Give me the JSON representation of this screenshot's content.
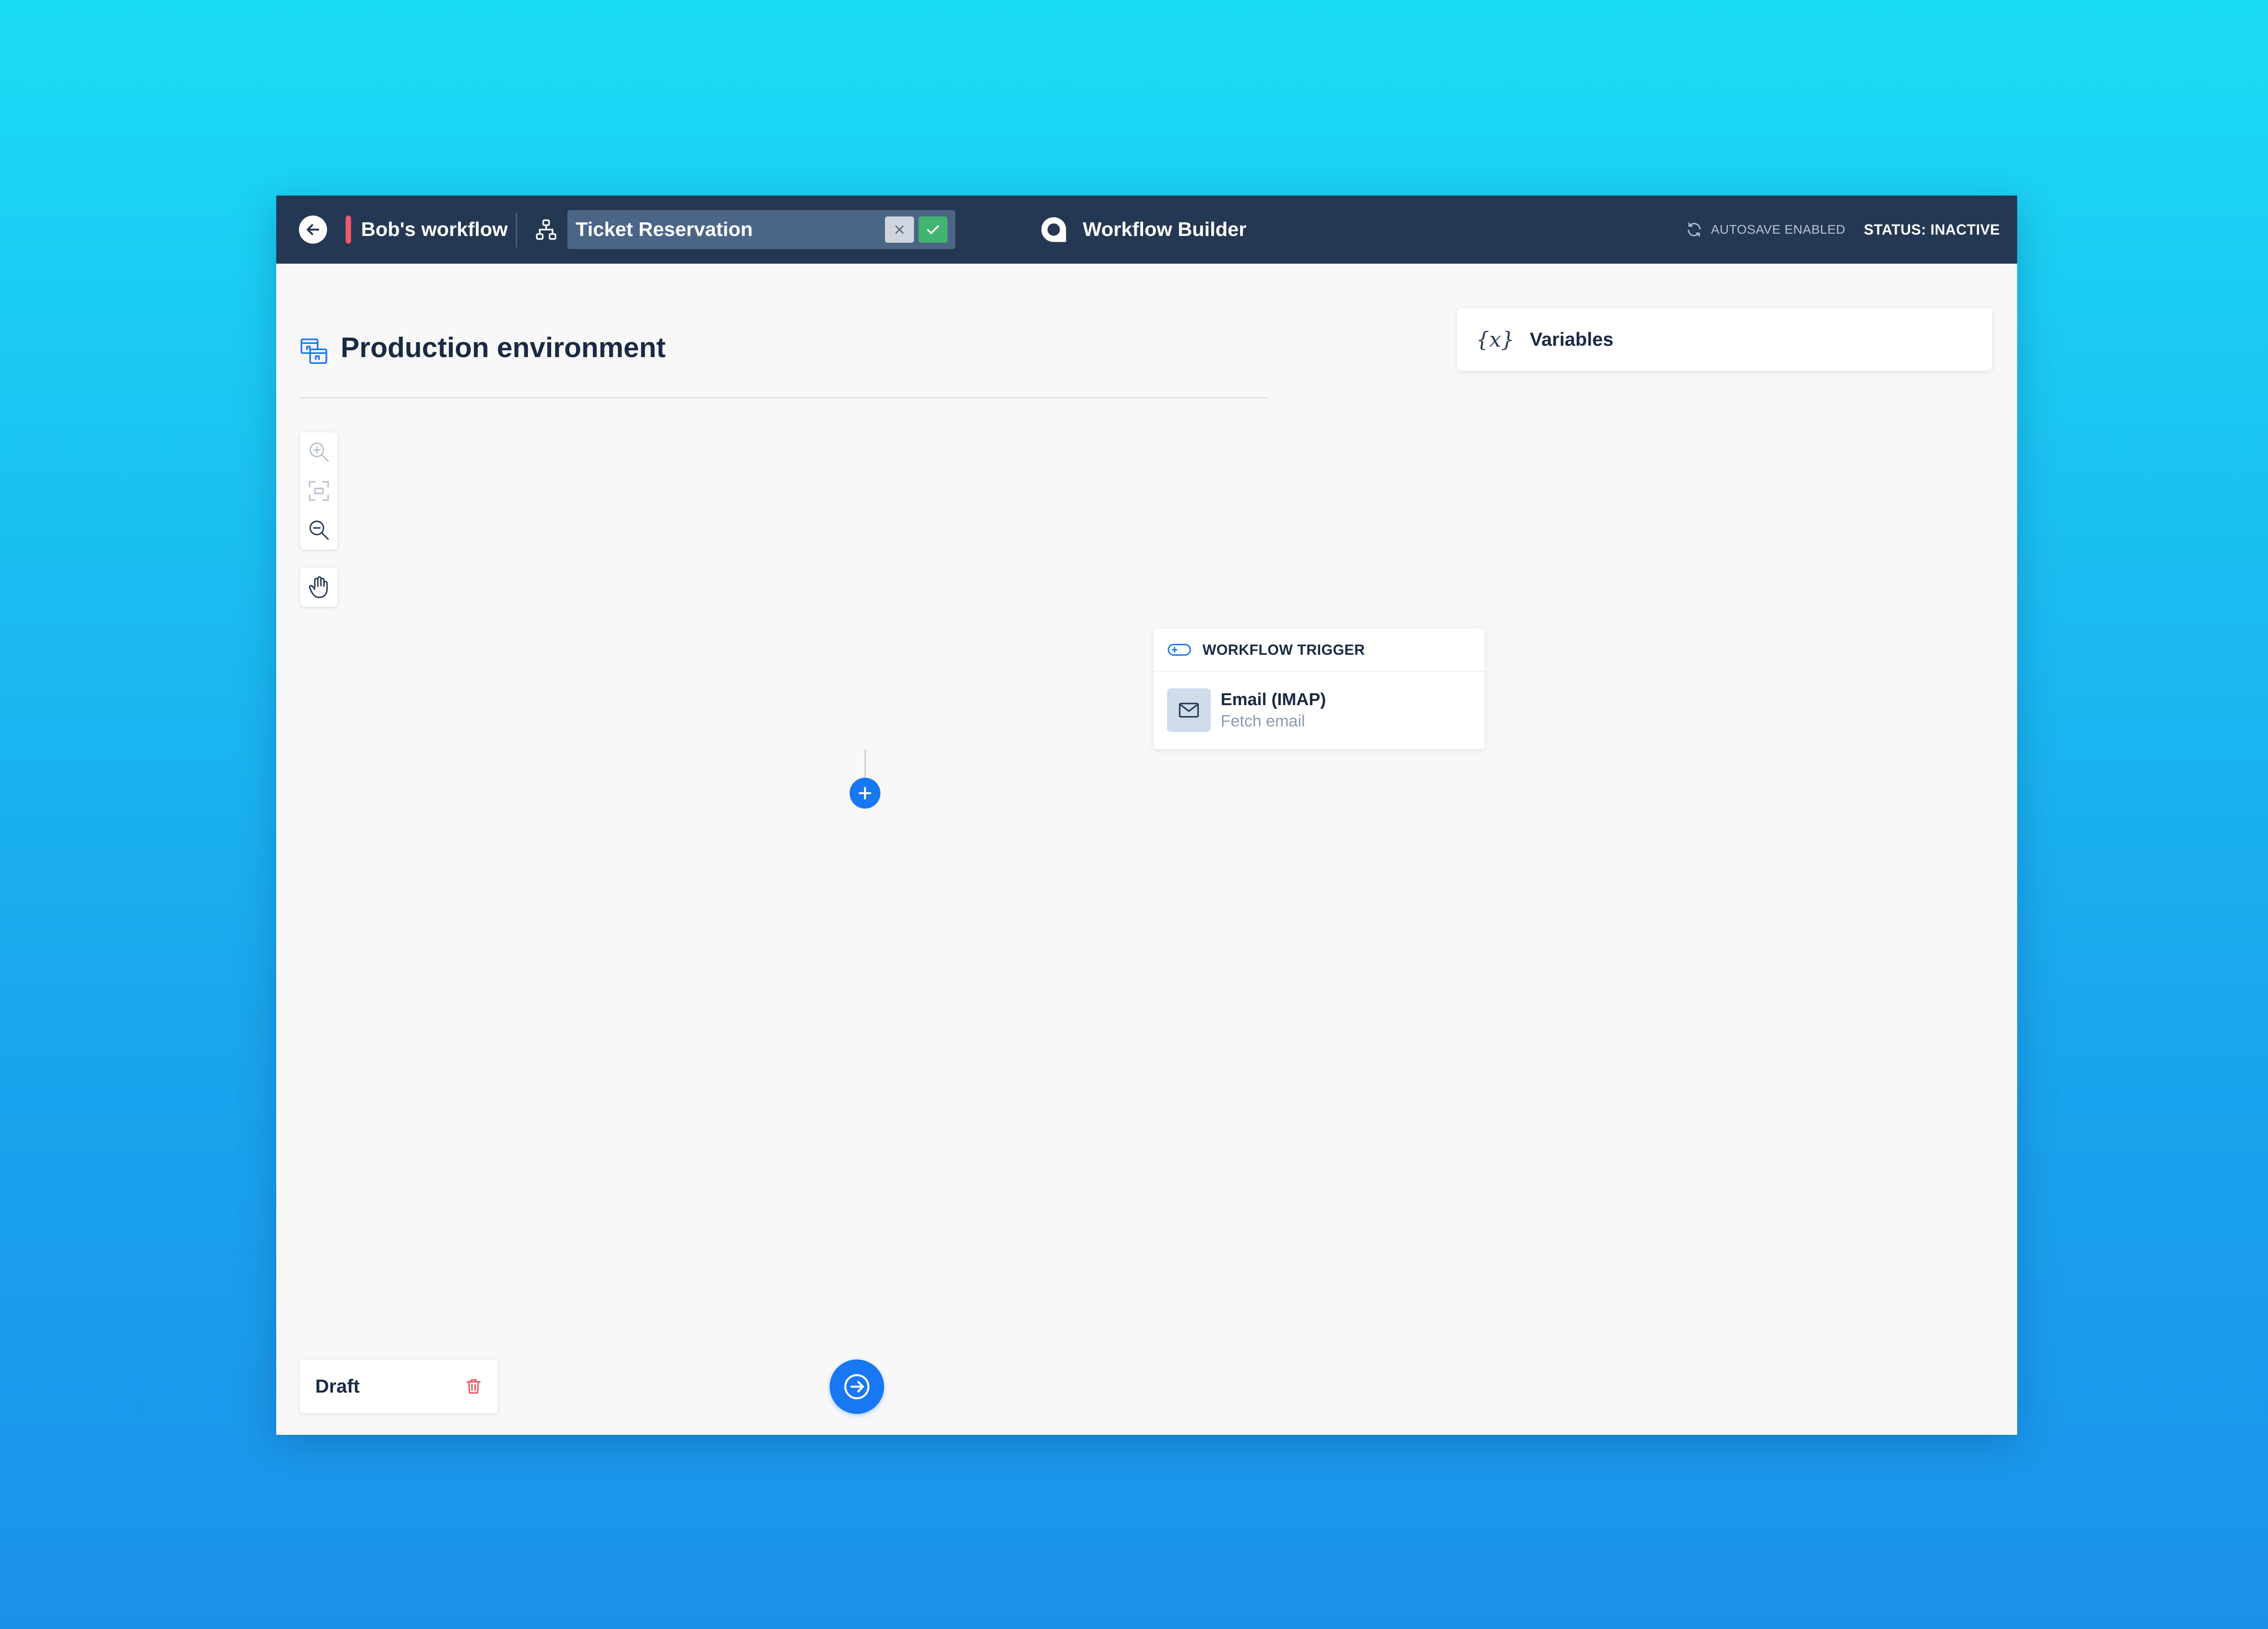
{
  "header": {
    "workflow_name": "Bob's workflow",
    "title_value": "Ticket Reservation",
    "brand_title": "Workflow Builder",
    "autosave": "AUTOSAVE ENABLED",
    "status": "STATUS: INACTIVE",
    "accent_color": "#ee5a6d"
  },
  "main": {
    "title": "Production environment",
    "variables_label": "Variables",
    "variables_icon": "{x}"
  },
  "trigger": {
    "header_label": "WORKFLOW TRIGGER",
    "app_name": "Email (IMAP)",
    "action": "Fetch email"
  },
  "footer": {
    "draft_label": "Draft"
  },
  "icons": {
    "back": "arrow-left-icon",
    "tree": "workflow-tree-icon",
    "cancel": "close-icon",
    "confirm": "check-icon",
    "brand": "brand-logo-icon",
    "autosave": "sync-icon",
    "environment": "environment-icon",
    "zoom_in": "zoom-in-icon",
    "fit": "fit-view-icon",
    "zoom_out": "zoom-out-icon",
    "pan": "hand-icon",
    "trigger": "trigger-icon",
    "email": "envelope-icon",
    "add": "plus-icon",
    "delete": "trash-icon",
    "next": "arrow-right-circle-icon"
  },
  "colors": {
    "topbar": "#253853",
    "primary": "#1877f2",
    "success": "#43b372",
    "danger": "#e8505b"
  }
}
